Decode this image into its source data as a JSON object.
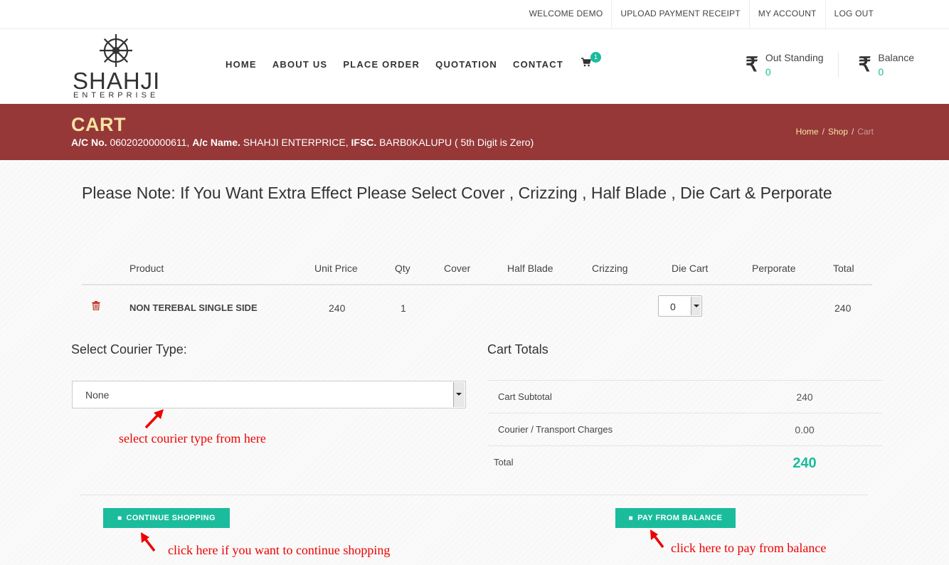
{
  "topbar": {
    "links": [
      "WELCOME DEMO",
      "UPLOAD PAYMENT RECEIPT",
      "MY ACCOUNT",
      "LOG OUT"
    ]
  },
  "brand": {
    "name": "SHAHJI",
    "subtitle": "ENTERPRISE"
  },
  "nav": {
    "items": [
      "HOME",
      "ABOUT US",
      "PLACE ORDER",
      "QUOTATION",
      "CONTACT"
    ],
    "cart_count": "1"
  },
  "balances": {
    "outstanding": {
      "label": "Out Standing",
      "value": "0",
      "currency": "₹"
    },
    "balance": {
      "label": "Balance",
      "value": "0",
      "currency": "₹"
    }
  },
  "banner": {
    "title": "CART",
    "account": {
      "acno_label": "A/C No.",
      "acno": "06020200000611,",
      "name_label": "A/c Name.",
      "name": "SHAHJI ENTERPRICE,",
      "ifsc_label": "IFSC.",
      "ifsc": "BARB0KALUPU ( 5th Digit is Zero)"
    },
    "breadcrumb": [
      "Home",
      "Shop",
      "Cart"
    ]
  },
  "note": "Please Note: If You Want Extra Effect Please Select Cover , Crizzing , Half Blade , Die Cart & Perporate",
  "cart_table": {
    "headers": [
      "Product",
      "Unit Price",
      "Qty",
      "Cover",
      "Half Blade",
      "Crizzing",
      "Die Cart",
      "Perporate",
      "Total"
    ],
    "rows": [
      {
        "product": "NON TEREBAL SINGLE SIDE",
        "unit_price": "240",
        "qty": "1",
        "die_cart": "0",
        "total": "240"
      }
    ]
  },
  "courier": {
    "title": "Select Courier Type:",
    "selected": "None",
    "hint": "select courier type from here"
  },
  "totals": {
    "title": "Cart Totals",
    "rows": [
      {
        "label": "Cart Subtotal",
        "value": "240"
      },
      {
        "label": "Courier / Transport Charges",
        "value": "0.00"
      },
      {
        "label": "Total",
        "value": "240"
      }
    ]
  },
  "actions": {
    "continue_label": "CONTINUE SHOPPING",
    "continue_hint": "click here if you want to continue shopping",
    "pay_label": "PAY FROM BALANCE",
    "pay_hint": "click here to pay from balance"
  },
  "colors": {
    "accent": "#1abc9c",
    "banner": "#963838",
    "title": "#f8e3a3",
    "annotation": "#ee0000"
  }
}
